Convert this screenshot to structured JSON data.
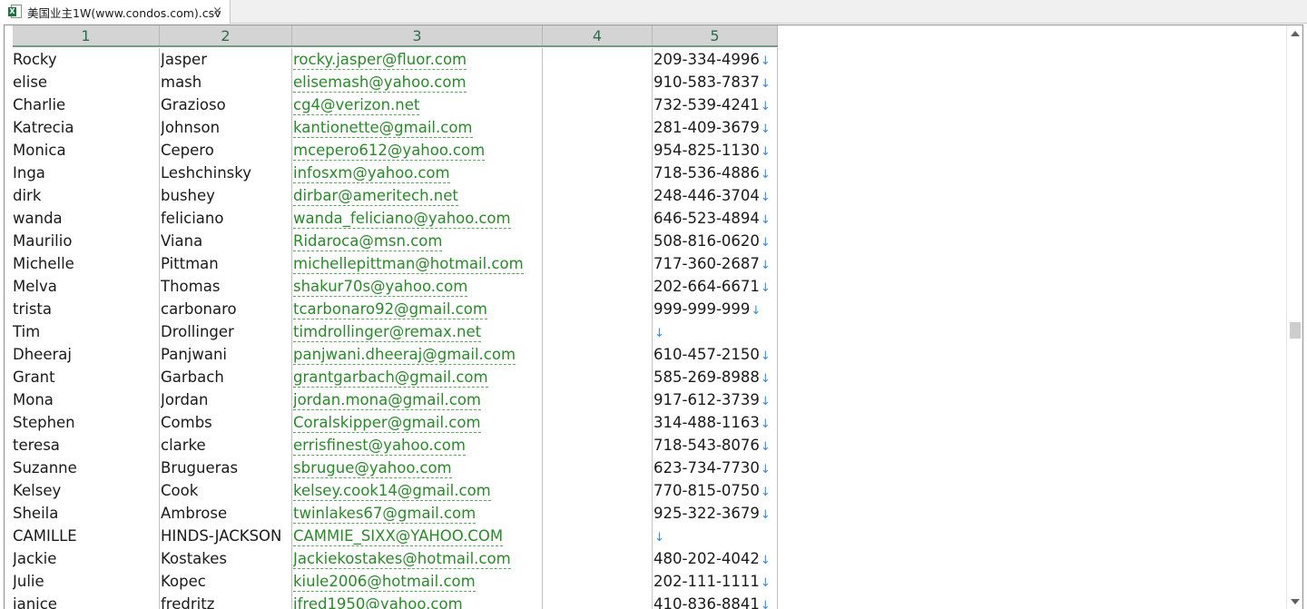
{
  "tab": {
    "title": "美国业主1W(www.condos.com).csv",
    "close_glyph": "×",
    "file_icon": "excel-csv-icon"
  },
  "columns": [
    "1",
    "2",
    "3",
    "4",
    "5"
  ],
  "arrow_glyph": "↓",
  "rows": [
    {
      "first": "Rocky",
      "last": "Jasper",
      "email": "rocky.jasper@fluor.com",
      "col4": "",
      "phone": "209-334-4996"
    },
    {
      "first": "elise",
      "last": "mash",
      "email": "elisemash@yahoo.com",
      "col4": "",
      "phone": "910-583-7837"
    },
    {
      "first": "Charlie",
      "last": "Grazioso",
      "email": "cg4@verizon.net",
      "col4": "",
      "phone": "732-539-4241"
    },
    {
      "first": "Katrecia",
      "last": "Johnson",
      "email": "kantionette@gmail.com",
      "col4": "",
      "phone": "281-409-3679"
    },
    {
      "first": "Monica",
      "last": "Cepero",
      "email": "mcepero612@yahoo.com",
      "col4": "",
      "phone": "954-825-1130"
    },
    {
      "first": "Inga",
      "last": "Leshchinsky",
      "email": "infosxm@yahoo.com",
      "col4": "",
      "phone": "718-536-4886"
    },
    {
      "first": "dirk",
      "last": "bushey",
      "email": "dirbar@ameritech.net",
      "col4": "",
      "phone": "248-446-3704"
    },
    {
      "first": "wanda",
      "last": "feliciano",
      "email": "wanda_feliciano@yahoo.com",
      "col4": "",
      "phone": "646-523-4894"
    },
    {
      "first": "Maurilio",
      "last": "Viana",
      "email": "Ridaroca@msn.com",
      "col4": "",
      "phone": "508-816-0620"
    },
    {
      "first": "Michelle",
      "last": "Pittman",
      "email": "michellepittman@hotmail.com",
      "col4": "",
      "phone": "717-360-2687"
    },
    {
      "first": "Melva",
      "last": "Thomas",
      "email": "shakur70s@yahoo.com",
      "col4": "",
      "phone": "202-664-6671"
    },
    {
      "first": "trista",
      "last": "carbonaro",
      "email": "tcarbonaro92@gmail.com",
      "col4": "",
      "phone": "999-999-999"
    },
    {
      "first": "Tim",
      "last": "Drollinger",
      "email": "timdrollinger@remax.net",
      "col4": "",
      "phone": ""
    },
    {
      "first": "Dheeraj",
      "last": "Panjwani",
      "email": "panjwani.dheeraj@gmail.com",
      "col4": "",
      "phone": "610-457-2150"
    },
    {
      "first": "Grant",
      "last": "Garbach",
      "email": "grantgarbach@gmail.com",
      "col4": "",
      "phone": "585-269-8988"
    },
    {
      "first": "Mona",
      "last": "Jordan",
      "email": "jordan.mona@gmail.com",
      "col4": "",
      "phone": "917-612-3739"
    },
    {
      "first": "Stephen",
      "last": "Combs",
      "email": "Coralskipper@gmail.com",
      "col4": "",
      "phone": "314-488-1163"
    },
    {
      "first": "teresa",
      "last": "clarke",
      "email": "errisfinest@yahoo.com",
      "col4": "",
      "phone": "718-543-8076"
    },
    {
      "first": "Suzanne",
      "last": "Brugueras",
      "email": "sbrugue@yahoo.com",
      "col4": "",
      "phone": "623-734-7730"
    },
    {
      "first": "Kelsey",
      "last": "Cook",
      "email": "kelsey.cook14@gmail.com",
      "col4": "",
      "phone": "770-815-0750"
    },
    {
      "first": "Sheila",
      "last": "Ambrose",
      "email": "twinlakes67@gmail.com",
      "col4": "",
      "phone": "925-322-3679"
    },
    {
      "first": "CAMILLE",
      "last": "HINDS-JACKSON",
      "email": "CAMMIE_SIXX@YAHOO.COM",
      "col4": "",
      "phone": ""
    },
    {
      "first": "Jackie",
      "last": "Kostakes",
      "email": "Jackiekostakes@hotmail.com",
      "col4": "",
      "phone": "480-202-4042"
    },
    {
      "first": "Julie",
      "last": "Kopec",
      "email": "kiule2006@hotmail.com",
      "col4": "",
      "phone": "202-111-1111"
    },
    {
      "first": "janice",
      "last": "fredritz",
      "email": "jfred1950@yahoo.com",
      "col4": "",
      "phone": "410-836-8841"
    }
  ]
}
